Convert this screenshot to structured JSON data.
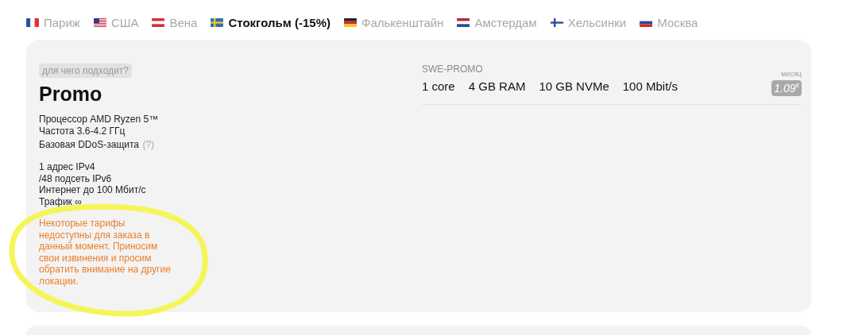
{
  "locations": [
    {
      "label": "Париж",
      "kind": "france",
      "selected": false
    },
    {
      "label": "США",
      "kind": "usa",
      "selected": false
    },
    {
      "label": "Вена",
      "kind": "austria",
      "selected": false
    },
    {
      "label": "Стокгольм (-15%)",
      "kind": "sweden",
      "selected": true
    },
    {
      "label": "Фалькенштайн",
      "kind": "germany",
      "selected": false
    },
    {
      "label": "Амстердам",
      "kind": "netherlands",
      "selected": false
    },
    {
      "label": "Хельсинки",
      "kind": "finland",
      "selected": false
    },
    {
      "label": "Москва",
      "kind": "russia",
      "selected": false
    }
  ],
  "plan": {
    "tag": "для чего подходит?",
    "title": "Promo",
    "feature_groups": [
      [
        {
          "text": "Процессор AMD Ryzen 5™"
        },
        {
          "text": "Частота 3.6-4.2 ГГц"
        },
        {
          "text": "Базовая DDoS-защита",
          "hint": "(?)"
        }
      ],
      [
        {
          "text": "1 адрес IPv4"
        },
        {
          "text": "/48 подсеть IPv6"
        },
        {
          "text": "Интернет до 100 Мбит/с"
        },
        {
          "text": "Трафик ∞"
        }
      ]
    ],
    "notice": "Некоторые тарифы недоступны для заказа в данный момент. Приносим свои извинения и просим обратить внимание на другие локации.",
    "tariffs": [
      {
        "name": "SWE-PROMO",
        "specs": [
          "1 core",
          "4 GB RAM",
          "10 GB NVMe",
          "100 Mbit/s"
        ],
        "period": "месяц",
        "price": "1.09$^{€}$",
        "disabled": true
      }
    ]
  }
}
